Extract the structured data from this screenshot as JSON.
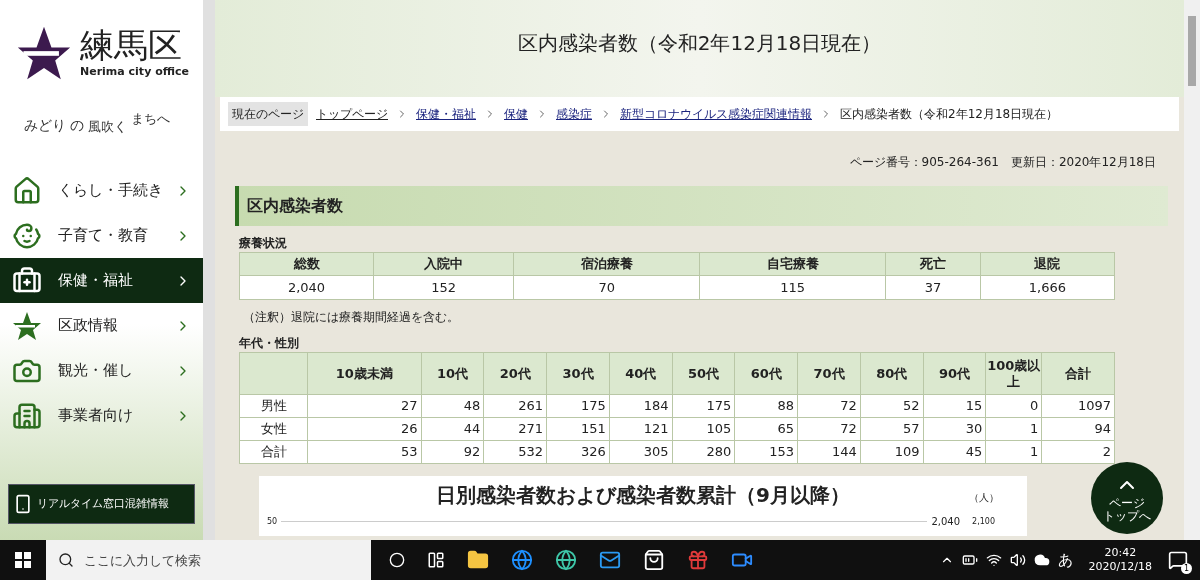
{
  "logo": {
    "name": "練馬区",
    "subtitle": "Nerima city office"
  },
  "slogan": {
    "part_1": "みどり",
    "part_2": "の",
    "part_3": "風吹く",
    "part_4": "まちへ"
  },
  "sidebar": {
    "items": [
      {
        "label": "くらし・手続き",
        "kind": "life",
        "selected": false
      },
      {
        "label": "子育て・教育",
        "kind": "child",
        "selected": false
      },
      {
        "label": "保健・福祉",
        "kind": "health",
        "selected": true
      },
      {
        "label": "区政情報",
        "kind": "city",
        "selected": false
      },
      {
        "label": "観光・催し",
        "kind": "camera",
        "selected": false
      },
      {
        "label": "事業者向け",
        "kind": "business",
        "selected": false
      }
    ],
    "realtime_button": "リアルタイム窓口混雑情報"
  },
  "page_title": "区内感染者数（令和2年12月18日現在）",
  "breadcrumb": {
    "label": "現在のページ",
    "links": [
      "トップページ",
      "保健・福祉",
      "保健",
      "感染症",
      "新型コロナウイルス感染症関連情報"
    ],
    "current": "区内感染者数（令和2年12月18日現在）"
  },
  "page_meta": "ページ番号：905-264-361　更新日：2020年12月18日",
  "section_heading": "区内感染者数",
  "status_table": {
    "caption": "療養状況",
    "columns": [
      "総数",
      "入院中",
      "宿泊療養",
      "自宅療養",
      "死亡",
      "退院"
    ],
    "values": [
      "2,040",
      "152",
      "70",
      "115",
      "37",
      "1,666"
    ]
  },
  "note": "（注釈）退院には療養期間経過を含む。",
  "age_table": {
    "caption": "年代・性別",
    "columns": [
      "10歳未満",
      "10代",
      "20代",
      "30代",
      "40代",
      "50代",
      "60代",
      "70代",
      "80代",
      "90代",
      "100歳以上",
      "合計"
    ],
    "rows": [
      {
        "label": "男性",
        "values": [
          "27",
          "48",
          "261",
          "175",
          "184",
          "175",
          "88",
          "72",
          "52",
          "15",
          "0",
          "1097"
        ]
      },
      {
        "label": "女性",
        "values": [
          "26",
          "44",
          "271",
          "151",
          "121",
          "105",
          "65",
          "72",
          "57",
          "30",
          "1",
          "94"
        ]
      },
      {
        "label": "合計",
        "values": [
          "53",
          "92",
          "532",
          "326",
          "305",
          "280",
          "153",
          "144",
          "109",
          "45",
          "1",
          "2"
        ]
      }
    ]
  },
  "page_top_button": {
    "line_1": "ページ",
    "line_2": "トップへ"
  },
  "chart": {
    "title": "日別感染者数および感染者数累計（9月以降）",
    "unit": "（人）",
    "left_tick": "50",
    "end_label": "2,040",
    "right_tick": "2,100"
  },
  "taskbar": {
    "search_placeholder": "ここに入力して検索",
    "ime": "あ",
    "time": "20:42",
    "date": "2020/12/18",
    "notifications": "1"
  }
}
